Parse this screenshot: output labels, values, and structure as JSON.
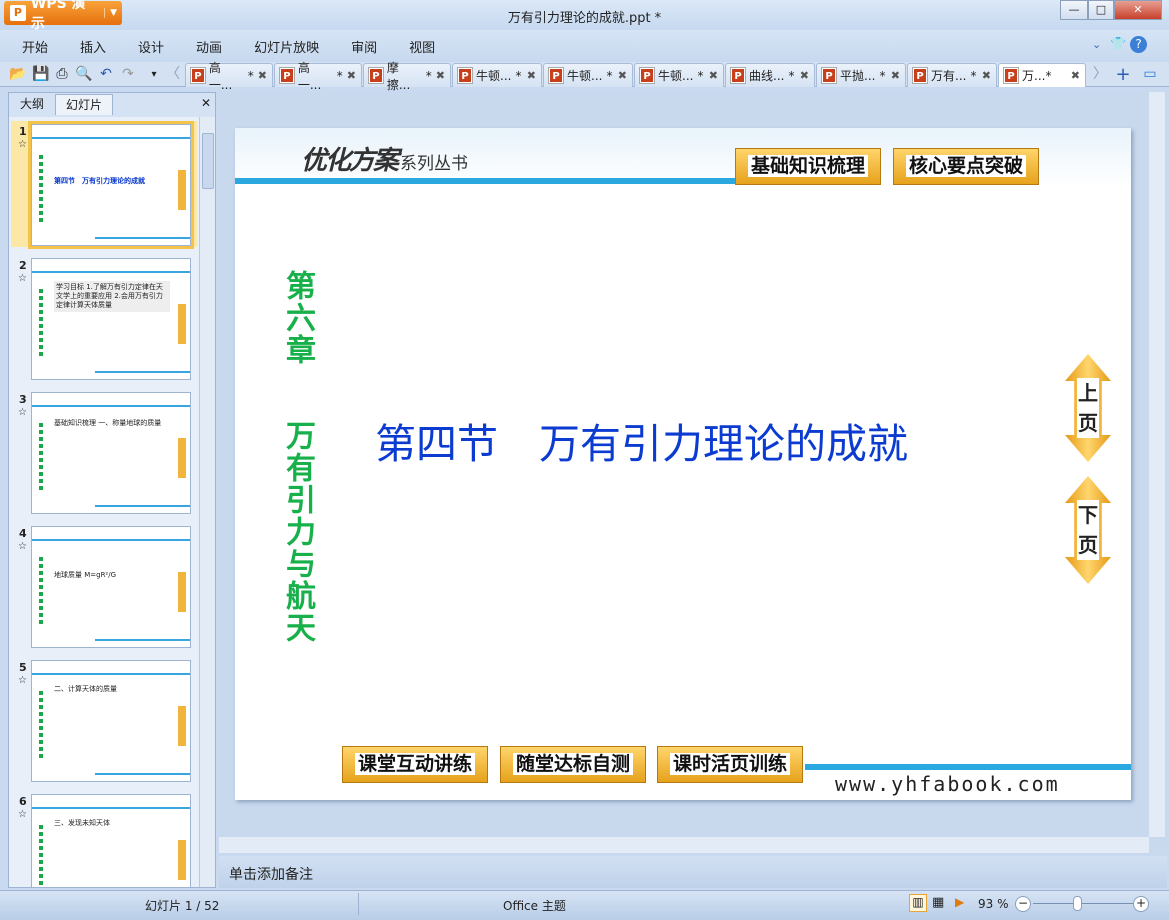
{
  "app": {
    "name": "WPS 演示",
    "title": "万有引力理论的成就.ppt *"
  },
  "window": {
    "minimize": "—",
    "maximize": "□",
    "close": "✕"
  },
  "menu": [
    "开始",
    "插入",
    "设计",
    "动画",
    "幻灯片放映",
    "审阅",
    "视图"
  ],
  "doc_tabs": [
    {
      "label": "高一...",
      "mod": "*"
    },
    {
      "label": "高一...",
      "mod": "*"
    },
    {
      "label": "摩擦...",
      "mod": "*"
    },
    {
      "label": "牛顿...",
      "mod": "*"
    },
    {
      "label": "牛顿...",
      "mod": "*"
    },
    {
      "label": "牛顿...",
      "mod": "*"
    },
    {
      "label": "曲线...",
      "mod": "*"
    },
    {
      "label": "平抛...",
      "mod": "*"
    },
    {
      "label": "万有...",
      "mod": "*"
    },
    {
      "label": "万...*",
      "mod": ""
    }
  ],
  "panel": {
    "tabs": [
      "大纲",
      "幻灯片"
    ],
    "close": "✕"
  },
  "thumbs": [
    {
      "num": "1",
      "text": "第四节　万有引力理论的成就"
    },
    {
      "num": "2",
      "text": "学习目标 1.了解万有引力定律在天文学上的重要应用 2.会用万有引力定律计算天体质量"
    },
    {
      "num": "3",
      "text": "基础知识梳理 一、称量地球的质量"
    },
    {
      "num": "4",
      "text": "地球质量 M=gR²/G"
    },
    {
      "num": "5",
      "text": "二、计算天体的质量"
    },
    {
      "num": "6",
      "text": "三、发现未知天体"
    }
  ],
  "slide": {
    "logo": "优化方案",
    "logo_sub": "系列丛书",
    "top_buttons": [
      "基础知识梳理",
      "核心要点突破"
    ],
    "chapter": "第六章",
    "chapter_title": "万有引力与航天",
    "title": "第四节　万有引力理论的成就",
    "prev": [
      "上",
      "页"
    ],
    "next": [
      "下",
      "页"
    ],
    "bottom_buttons": [
      "课堂互动讲练",
      "随堂达标自测",
      "课时活页训练"
    ],
    "url": "www.yhfabook.com"
  },
  "notes_placeholder": "单击添加备注",
  "status": {
    "slide": "幻灯片 1 / 52",
    "theme": "Office 主题",
    "zoom": "93 %"
  }
}
